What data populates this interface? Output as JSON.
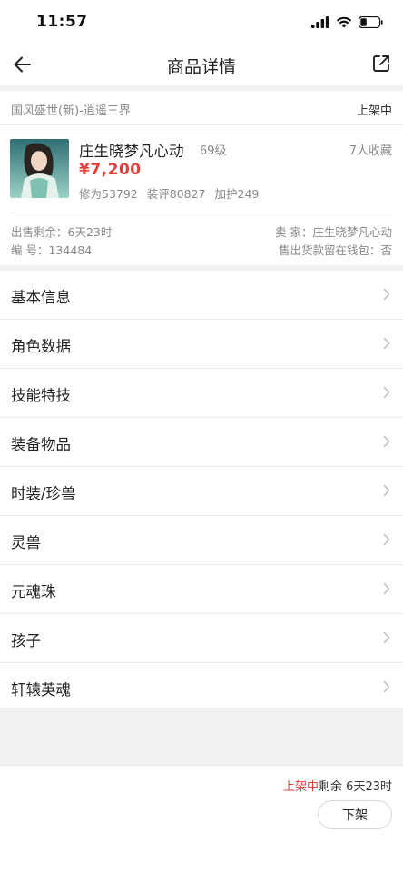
{
  "status_bar": {
    "time": "11:57"
  },
  "nav": {
    "title": "商品详情"
  },
  "listing": {
    "server": "国风盛世(新)-逍遥三界",
    "status": "上架中"
  },
  "product": {
    "name": "庄生晓梦凡心动",
    "level": "69级",
    "favorites": "7人收藏",
    "price": "¥7,200",
    "stats": [
      "修为53792",
      "装评80827",
      "加护249"
    ],
    "time_left_label": "出售剩余：",
    "time_left_value": "6天23时",
    "id_label": "编 号：",
    "id_value": "134484",
    "seller_label": "卖 家：",
    "seller_value": "庄生晓梦凡心动",
    "wallet_label": "售出货款留在钱包：",
    "wallet_value": "否"
  },
  "menu": [
    {
      "label": "基本信息"
    },
    {
      "label": "角色数据"
    },
    {
      "label": "技能特技"
    },
    {
      "label": "装备物品"
    },
    {
      "label": "时装/珍兽"
    },
    {
      "label": "灵兽"
    },
    {
      "label": "元魂珠"
    },
    {
      "label": "孩子"
    },
    {
      "label": "轩辕英魂"
    }
  ],
  "footer": {
    "status": "上架中",
    "remaining": "剩余 6天23时",
    "delist_label": "下架"
  },
  "colors": {
    "accent_red": "#e0413b",
    "muted_text": "#888888",
    "band_gray": "#f2f2f2"
  },
  "icons": [
    "back-arrow-icon",
    "share-icon",
    "signal-icon",
    "wifi-icon",
    "battery-icon",
    "chevron-right-icon"
  ]
}
